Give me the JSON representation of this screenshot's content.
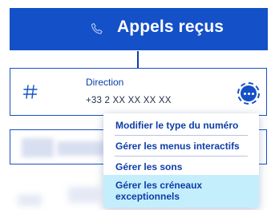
{
  "header": {
    "title": "Appels reçus",
    "icon": "phone-icon"
  },
  "card": {
    "icon": "hash-icon",
    "name": "Direction",
    "number": "+33 2 XX XX XX XX",
    "more_icon": "more-dots-icon"
  },
  "menu": {
    "items": [
      {
        "label": "Modifier le type du numéro"
      },
      {
        "label": "Gérer les menus interactifs"
      },
      {
        "label": "Gérer les sons"
      },
      {
        "label": "Gérer les créneaux exceptionnels"
      }
    ]
  },
  "colors": {
    "primary": "#1450c8",
    "highlight": "#c5eefc",
    "text": "#0c3ea8"
  }
}
